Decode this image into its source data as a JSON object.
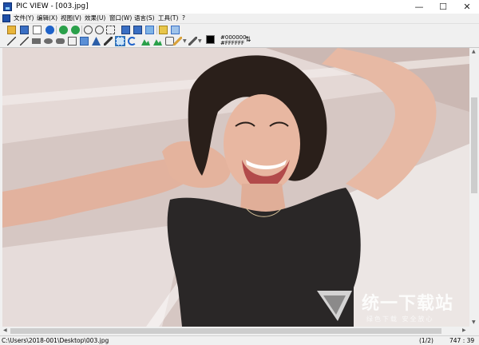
{
  "window": {
    "title": "PIC VIEW  - [003.jpg]",
    "minimize_glyph": "—",
    "maximize_glyph": "☐",
    "close_glyph": "✕"
  },
  "menu": {
    "items": [
      {
        "label": "文件(Y)"
      },
      {
        "label": "编辑(X)"
      },
      {
        "label": "视图(V)"
      },
      {
        "label": "效果(U)"
      },
      {
        "label": "窗口(W)"
      },
      {
        "label": "语言(S)"
      },
      {
        "label": "工具(T)"
      },
      {
        "label": "?"
      }
    ]
  },
  "toolbar_row1": {
    "icons": [
      "open-icon",
      "save-icon",
      "print-preview-icon",
      "print-icon",
      "info-icon",
      "prev-icon",
      "next-icon",
      "zoom-in-icon",
      "zoom-out-icon",
      "fit-icon",
      "first-icon",
      "last-icon",
      "fullscreen-icon",
      "slideshow-icon",
      "folder-icon",
      "copy-icon"
    ]
  },
  "toolbar_row2": {
    "icons": [
      "line-icon",
      "arrow-icon",
      "rect-icon",
      "ellipse-icon",
      "rounded-rect-icon",
      "crop-icon",
      "clone-icon",
      "text-icon",
      "pen-icon",
      "select-icon",
      "undo-icon",
      "mountain-icon",
      "flip-icon",
      "rotate-icon",
      "pencil-icon",
      "brush-icon"
    ],
    "foreground_color_label": "#000000",
    "background_color_label": "#FFFFFF",
    "foreground_color": "#000000",
    "background_color": "#FFFFFF"
  },
  "status": {
    "path": "C:\\Users\\2018-001\\Desktop\\003.jpg",
    "page": "(1/2)",
    "coords": "747 : 39"
  },
  "watermark": {
    "text": "统一下载站",
    "subtext": "绿色下载 安全放心"
  },
  "colors": {
    "accent": "#3c7fb1",
    "window_bg": "#f0f0f0",
    "titlebar_bg": "#ffffff"
  }
}
